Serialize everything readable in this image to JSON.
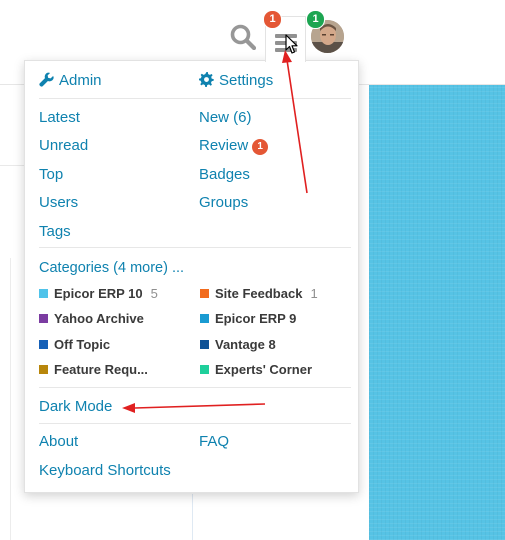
{
  "header": {
    "search_icon": "search-icon",
    "menu_icon": "hamburger-icon",
    "menu_badge": "1",
    "avatar_badge": "1",
    "colors": {
      "badge_red": "#e45735",
      "badge_green": "#1ca551",
      "link": "#0f82af",
      "accent_panel": "#56c3e5"
    }
  },
  "menu": {
    "admin": "Admin",
    "settings": "Settings",
    "latest": "Latest",
    "new": "New (6)",
    "unread": "Unread",
    "review": "Review",
    "review_badge": "1",
    "top": "Top",
    "badges": "Badges",
    "users": "Users",
    "groups": "Groups",
    "tags": "Tags",
    "categories_header": "Categories (4 more) ...",
    "categories": [
      {
        "name": "Epicor ERP 10",
        "count": "5",
        "color": "#4fc3ea"
      },
      {
        "name": "Site Feedback",
        "count": "1",
        "color": "#f26b1d"
      },
      {
        "name": "Yahoo Archive",
        "count": "",
        "color": "#7b3ca1"
      },
      {
        "name": "Epicor ERP 9",
        "count": "",
        "color": "#1a9bd2"
      },
      {
        "name": "Off Topic",
        "count": "",
        "color": "#1660b7"
      },
      {
        "name": "Vantage 8",
        "count": "",
        "color": "#0e5296"
      },
      {
        "name": "Feature Requ...",
        "count": "",
        "color": "#b8860b"
      },
      {
        "name": "Experts' Corner",
        "count": "",
        "color": "#1fcf9b"
      }
    ],
    "dark_mode": "Dark Mode",
    "about": "About",
    "faq": "FAQ",
    "keyboard_shortcuts": "Keyboard Shortcuts"
  }
}
